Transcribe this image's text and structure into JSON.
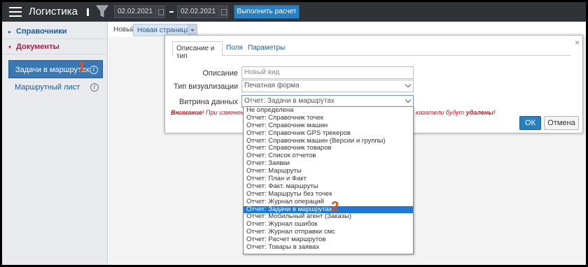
{
  "header": {
    "title": "Логистика",
    "date_from": "02.02.2021",
    "date_to": "02.02.2021",
    "run_button": "Выполнить расчет"
  },
  "sidebar": {
    "sections": [
      {
        "label": "Справочники",
        "arrow": "▸"
      },
      {
        "label": "Документы",
        "arrow": "▾"
      }
    ],
    "items": [
      {
        "label": "Задачи в маршрутах"
      },
      {
        "label": "Маршрутный лист"
      }
    ],
    "info_glyph": "i"
  },
  "tabs": {
    "new": "Новый",
    "new_page": "Новая страница"
  },
  "dialog": {
    "close": "×",
    "tabs": [
      "Описание и тип",
      "Поля",
      "Параметры"
    ],
    "fields": {
      "description_label": "Описание",
      "description_placeholder": "Новый вид",
      "visualization_label": "Тип визуализации",
      "visualization_value": "Печатная форма",
      "showcase_label": "Витрина данных",
      "showcase_value": "Отчет: Задачи в маршрутах"
    },
    "warning_prefix": "Внимание",
    "warning_text": "! При изменен",
    "warning_tail_text": "казатели будут",
    "warning_tail_bold": "удалены",
    "warning_tail_end": "!",
    "ok": "ОК",
    "cancel": "Отмена"
  },
  "dropdown": {
    "selected_index": 13,
    "options": [
      "Не определена",
      "Отчет: Справочник точек",
      "Отчет: Справочник машин",
      "Отчет: Справочник GPS трекеров",
      "Отчет: Справочник машин (Версии и группы)",
      "Отчет: Справочник товаров",
      "Отчет: Список отчетов",
      "Отчет: Заявки",
      "Отчет: Маршруты",
      "Отчет: План и Факт",
      "Отчет: Факт. маршруты",
      "Отчет: Маршруты без точек",
      "Отчет: Журнал операций",
      "Отчет: Задачи в маршрутах",
      "Отчет: Мобильный агент (Заказы)",
      "Отчет: Журнал ошибок",
      "Отчет: Журнал отправки смс",
      "Отчет: Расчет маршрутов",
      "Отчет: Товары в заявах"
    ]
  },
  "annotations": {
    "one": "1",
    "two": "2"
  },
  "colors": {
    "accent": "#2a7fc0",
    "annotation": "#e0511c",
    "warning": "#d0121b",
    "selected_option": "#1e79d6"
  }
}
